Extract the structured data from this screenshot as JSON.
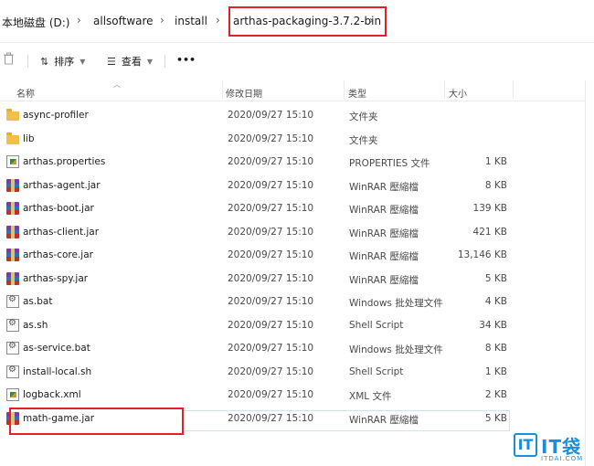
{
  "breadcrumb": {
    "items": [
      "本地磁盘 (D:)",
      "allsoftware",
      "install",
      "arthas-packaging-3.7.2-bin"
    ],
    "separator": "›"
  },
  "toolbar": {
    "delete_icon": "trash-icon",
    "sort_label": "排序",
    "sort_icon": "sort-arrows-icon",
    "view_label": "查看",
    "view_icon": "list-view-icon",
    "more_label": "•••"
  },
  "columns": {
    "name": "名称",
    "date": "修改日期",
    "type": "类型",
    "size": "大小"
  },
  "files": [
    {
      "name": "async-profiler",
      "date": "2020/09/27 15:10",
      "type": "文件夹",
      "size": "",
      "icon": "folder-icon"
    },
    {
      "name": "lib",
      "date": "2020/09/27 15:10",
      "type": "文件夹",
      "size": "",
      "icon": "folder-icon"
    },
    {
      "name": "arthas.properties",
      "date": "2020/09/27 15:10",
      "type": "PROPERTIES 文件",
      "size": "1 KB",
      "icon": "properties-file-icon"
    },
    {
      "name": "arthas-agent.jar",
      "date": "2020/09/27 15:10",
      "type": "WinRAR 壓縮檔",
      "size": "8 KB",
      "icon": "winrar-archive-icon"
    },
    {
      "name": "arthas-boot.jar",
      "date": "2020/09/27 15:10",
      "type": "WinRAR 壓縮檔",
      "size": "139 KB",
      "icon": "winrar-archive-icon"
    },
    {
      "name": "arthas-client.jar",
      "date": "2020/09/27 15:10",
      "type": "WinRAR 壓縮檔",
      "size": "421 KB",
      "icon": "winrar-archive-icon"
    },
    {
      "name": "arthas-core.jar",
      "date": "2020/09/27 15:10",
      "type": "WinRAR 壓縮檔",
      "size": "13,146 KB",
      "icon": "winrar-archive-icon"
    },
    {
      "name": "arthas-spy.jar",
      "date": "2020/09/27 15:10",
      "type": "WinRAR 壓縮檔",
      "size": "5 KB",
      "icon": "winrar-archive-icon"
    },
    {
      "name": "as.bat",
      "date": "2020/09/27 15:10",
      "type": "Windows 批处理文件",
      "size": "4 KB",
      "icon": "batch-file-icon"
    },
    {
      "name": "as.sh",
      "date": "2020/09/27 15:10",
      "type": "Shell Script",
      "size": "34 KB",
      "icon": "shell-script-icon"
    },
    {
      "name": "as-service.bat",
      "date": "2020/09/27 15:10",
      "type": "Windows 批处理文件",
      "size": "8 KB",
      "icon": "batch-file-icon"
    },
    {
      "name": "install-local.sh",
      "date": "2020/09/27 15:10",
      "type": "Shell Script",
      "size": "1 KB",
      "icon": "shell-script-icon"
    },
    {
      "name": "logback.xml",
      "date": "2020/09/27 15:10",
      "type": "XML 文件",
      "size": "2 KB",
      "icon": "xml-file-icon"
    },
    {
      "name": "math-game.jar",
      "date": "2020/09/27 15:10",
      "type": "WinRAR 壓縮檔",
      "size": "5 KB",
      "icon": "winrar-archive-icon"
    }
  ],
  "watermark": {
    "logo_letter": "IT",
    "text": "IT袋",
    "sub": "ITDAI.COM"
  },
  "colors": {
    "highlight": "#e0202a",
    "watermark": "#1a8fd8"
  }
}
